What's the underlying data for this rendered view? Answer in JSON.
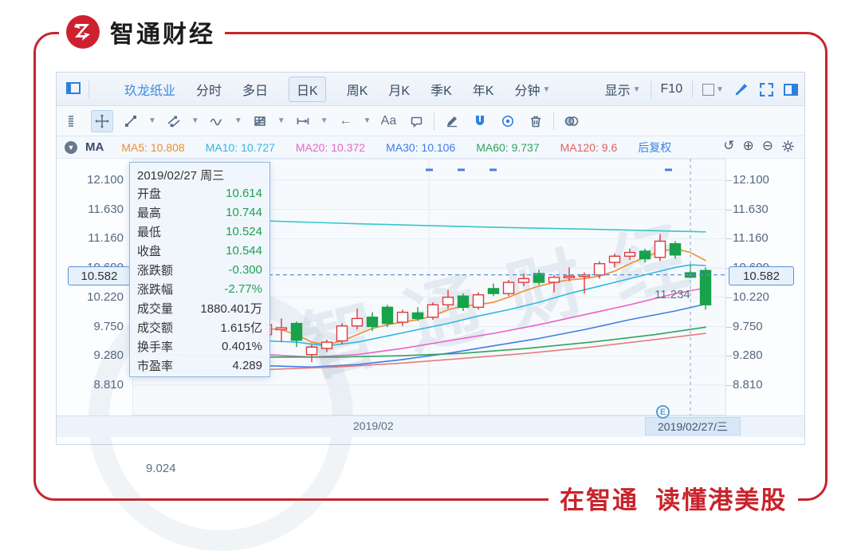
{
  "brand": {
    "logo_text": "智通财经",
    "slogan": "在智通  读懂港美股",
    "brand_red": "#c8242c"
  },
  "tabbar": {
    "stock_name": "玖龙纸业",
    "tabs": [
      "分时",
      "多日",
      "日K",
      "周K",
      "月K",
      "季K",
      "年K"
    ],
    "active_tab": "日K",
    "minute_label": "分钟",
    "display_label": "显示",
    "f10_label": "F10"
  },
  "toolbar": {
    "items": [
      {
        "icon": "grip-icon"
      },
      {
        "icon": "move-icon",
        "active": true
      },
      {
        "icon": "trend-line-icon",
        "caret": true
      },
      {
        "icon": "channel-icon",
        "caret": true
      },
      {
        "icon": "wave-icon",
        "caret": true
      },
      {
        "icon": "fib-grid-icon",
        "caret": true
      },
      {
        "icon": "measure-icon",
        "caret": true
      },
      {
        "icon": "arrow-left-icon",
        "caret": true,
        "glyph": "←"
      },
      {
        "icon": "text-tool-icon",
        "glyph": "Aa"
      },
      {
        "icon": "comment-icon"
      },
      {
        "divider": true
      },
      {
        "icon": "pencil-icon"
      },
      {
        "icon": "magnet-icon",
        "blue": true
      },
      {
        "icon": "target-icon",
        "blue": true
      },
      {
        "icon": "trash-icon"
      },
      {
        "divider": true
      },
      {
        "icon": "venn-icon"
      }
    ]
  },
  "legend": {
    "ma_label": "MA",
    "items": [
      {
        "label": "MA5: 10.808",
        "color": "#ef8d2f"
      },
      {
        "label": "MA10: 10.727",
        "color": "#2fb9e0"
      },
      {
        "label": "MA20: 10.372",
        "color": "#ea64c8"
      },
      {
        "label": "MA30: 10.106",
        "color": "#3f7de8"
      },
      {
        "label": "MA60: 9.737",
        "color": "#31a35e"
      },
      {
        "label": "MA120: 9.6",
        "color": "#e35f5f"
      }
    ],
    "adjust_label": "后复权"
  },
  "tooltip": {
    "title": "2019/02/27 周三",
    "rows": [
      {
        "label": "开盘",
        "value": "10.614",
        "tone": "green"
      },
      {
        "label": "最高",
        "value": "10.744",
        "tone": "green"
      },
      {
        "label": "最低",
        "value": "10.524",
        "tone": "green"
      },
      {
        "label": "收盘",
        "value": "10.544",
        "tone": "green"
      },
      {
        "label": "涨跌额",
        "value": "-0.300",
        "tone": "green"
      },
      {
        "label": "涨跌幅",
        "value": "-2.77%",
        "tone": "green"
      },
      {
        "label": "成交量",
        "value": "1880.401万",
        "tone": "dark"
      },
      {
        "label": "成交额",
        "value": "1.615亿",
        "tone": "dark"
      },
      {
        "label": "换手率",
        "value": "0.401%",
        "tone": "dark"
      },
      {
        "label": "市盈率",
        "value": "4.289",
        "tone": "dark"
      }
    ]
  },
  "axis": {
    "y_labels": [
      "12.100",
      "11.630",
      "11.160",
      "10.690",
      "10.220",
      "9.750",
      "9.280",
      "8.810"
    ],
    "current_price": "10.582",
    "x_label": "2019/02",
    "x_current": "2019/02/27/三",
    "high_label": "11.234",
    "low_label": "9.024",
    "event_label": "E"
  },
  "chart_data": {
    "type": "candlestick",
    "title": "玖龙纸业 日K 后复权",
    "y_axis_ticks": [
      12.1,
      11.63,
      11.16,
      10.69,
      10.22,
      9.75,
      9.28,
      8.81
    ],
    "ylim": [
      8.6,
      12.25
    ],
    "latest_price": 10.582,
    "high_marker": 11.234,
    "low_marker": 9.024,
    "x_labels": [
      "2019/02",
      "2019/02/27/三"
    ],
    "crosshair_index": 28,
    "up_color": "#e0393b",
    "down_color": "#18a24b",
    "x_start": 168,
    "x_step": 19,
    "candles": [
      [
        9.62,
        9.84,
        9.52,
        9.78
      ],
      [
        9.7,
        9.88,
        9.5,
        9.73
      ],
      [
        9.8,
        9.83,
        9.42,
        9.53
      ],
      [
        9.3,
        9.46,
        9.18,
        9.42
      ],
      [
        9.4,
        9.54,
        9.34,
        9.5
      ],
      [
        9.52,
        9.8,
        9.46,
        9.76
      ],
      [
        9.76,
        10.04,
        9.7,
        9.88
      ],
      [
        9.9,
        9.98,
        9.68,
        9.75
      ],
      [
        10.06,
        10.1,
        9.74,
        9.8
      ],
      [
        9.82,
        10.02,
        9.76,
        9.98
      ],
      [
        9.97,
        10.06,
        9.84,
        9.88
      ],
      [
        9.9,
        10.14,
        9.86,
        10.1
      ],
      [
        10.1,
        10.34,
        10.04,
        10.22
      ],
      [
        10.24,
        10.28,
        10.0,
        10.06
      ],
      [
        10.06,
        10.3,
        10.02,
        10.26
      ],
      [
        10.36,
        10.44,
        10.24,
        10.28
      ],
      [
        10.28,
        10.5,
        10.24,
        10.46
      ],
      [
        10.46,
        10.6,
        10.4,
        10.52
      ],
      [
        10.6,
        10.66,
        10.42,
        10.46
      ],
      [
        10.46,
        10.58,
        10.3,
        10.54
      ],
      [
        10.54,
        10.7,
        10.48,
        10.56
      ],
      [
        10.56,
        10.62,
        10.28,
        10.58
      ],
      [
        10.58,
        10.8,
        10.52,
        10.76
      ],
      [
        10.78,
        10.92,
        10.7,
        10.88
      ],
      [
        10.88,
        11.0,
        10.82,
        10.94
      ],
      [
        10.96,
        11.0,
        10.78,
        10.84
      ],
      [
        10.86,
        11.234,
        10.8,
        11.12
      ],
      [
        11.08,
        11.12,
        10.84,
        10.9
      ],
      [
        10.614,
        10.744,
        10.524,
        10.544
      ],
      [
        10.65,
        10.7,
        10.02,
        10.1
      ]
    ],
    "ma_lines": {
      "MA5": {
        "color": "#ef8d2f",
        "points": [
          [
            168,
            9.72
          ],
          [
            187,
            9.7
          ],
          [
            206,
            9.62
          ],
          [
            225,
            9.5
          ],
          [
            244,
            9.46
          ],
          [
            263,
            9.52
          ],
          [
            282,
            9.62
          ],
          [
            301,
            9.72
          ],
          [
            320,
            9.78
          ],
          [
            339,
            9.82
          ],
          [
            358,
            9.86
          ],
          [
            377,
            9.92
          ],
          [
            396,
            10.02
          ],
          [
            415,
            10.08
          ],
          [
            434,
            10.1
          ],
          [
            453,
            10.14
          ],
          [
            472,
            10.22
          ],
          [
            491,
            10.32
          ],
          [
            510,
            10.4
          ],
          [
            529,
            10.46
          ],
          [
            548,
            10.5
          ],
          [
            567,
            10.52
          ],
          [
            586,
            10.56
          ],
          [
            605,
            10.64
          ],
          [
            624,
            10.76
          ],
          [
            643,
            10.86
          ],
          [
            662,
            10.96
          ],
          [
            681,
            11.0
          ],
          [
            700,
            10.94
          ],
          [
            719,
            10.81
          ]
        ]
      },
      "MA10": {
        "color": "#2fb9e0",
        "points": [
          [
            168,
            9.52
          ],
          [
            206,
            9.5
          ],
          [
            244,
            9.44
          ],
          [
            282,
            9.5
          ],
          [
            320,
            9.6
          ],
          [
            358,
            9.7
          ],
          [
            396,
            9.8
          ],
          [
            434,
            9.92
          ],
          [
            472,
            10.02
          ],
          [
            510,
            10.14
          ],
          [
            548,
            10.28
          ],
          [
            586,
            10.4
          ],
          [
            624,
            10.52
          ],
          [
            662,
            10.64
          ],
          [
            681,
            10.7
          ],
          [
            700,
            10.74
          ],
          [
            719,
            10.73
          ]
        ]
      },
      "MA20": {
        "color": "#ea64c8",
        "points": [
          [
            168,
            9.3
          ],
          [
            225,
            9.26
          ],
          [
            282,
            9.3
          ],
          [
            339,
            9.4
          ],
          [
            396,
            9.52
          ],
          [
            453,
            9.64
          ],
          [
            510,
            9.78
          ],
          [
            567,
            9.94
          ],
          [
            624,
            10.1
          ],
          [
            681,
            10.28
          ],
          [
            719,
            10.37
          ]
        ]
      },
      "MA30": {
        "color": "#3f7de8",
        "points": [
          [
            168,
            9.12
          ],
          [
            225,
            9.1
          ],
          [
            282,
            9.14
          ],
          [
            339,
            9.22
          ],
          [
            396,
            9.32
          ],
          [
            453,
            9.44
          ],
          [
            510,
            9.56
          ],
          [
            567,
            9.7
          ],
          [
            624,
            9.86
          ],
          [
            681,
            10.0
          ],
          [
            719,
            10.11
          ]
        ]
      },
      "MA60": {
        "color": "#31a35e",
        "points": [
          [
            0,
            9.32
          ],
          [
            85,
            9.28
          ],
          [
            168,
            9.26
          ],
          [
            255,
            9.26
          ],
          [
            335,
            9.28
          ],
          [
            415,
            9.32
          ],
          [
            495,
            9.4
          ],
          [
            575,
            9.5
          ],
          [
            655,
            9.62
          ],
          [
            719,
            9.74
          ]
        ]
      },
      "MA120": {
        "color": "#e87c7c",
        "points": [
          [
            0,
            9.02
          ],
          [
            85,
            9.04
          ],
          [
            168,
            9.06
          ],
          [
            255,
            9.1
          ],
          [
            335,
            9.16
          ],
          [
            415,
            9.24
          ],
          [
            495,
            9.32
          ],
          [
            575,
            9.42
          ],
          [
            655,
            9.54
          ],
          [
            719,
            9.64
          ]
        ]
      },
      "MA250": {
        "color": "#35c8c8",
        "points": [
          [
            0,
            11.52
          ],
          [
            135,
            11.46
          ],
          [
            285,
            11.4
          ],
          [
            435,
            11.35
          ],
          [
            585,
            11.31
          ],
          [
            719,
            11.27
          ]
        ]
      }
    }
  }
}
